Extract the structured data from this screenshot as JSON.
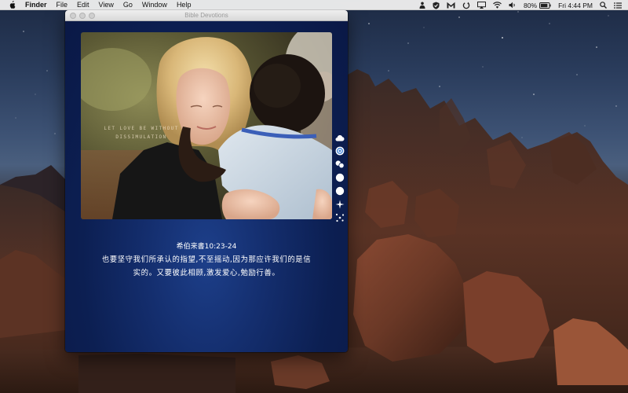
{
  "menubar": {
    "app_name": "Finder",
    "items": [
      "File",
      "Edit",
      "View",
      "Go",
      "Window",
      "Help"
    ],
    "battery_percent": "80%",
    "clock": "Fri 4:44 PM",
    "status_icons": [
      "user-icon",
      "shield-icon",
      "mail-icon",
      "sync-icon",
      "airplay-icon",
      "wifi-icon",
      "volume-icon",
      "battery-icon",
      "search-icon",
      "notification-center-icon"
    ]
  },
  "window": {
    "title": "Bible Devotions"
  },
  "photo": {
    "caption_line1": "LET LOVE BE WITHOUT",
    "caption_line2": "DISSIMULATION"
  },
  "toolbar": {
    "tools": [
      "cloud-icon",
      "refresh-icon",
      "share-icon",
      "circle-icon",
      "circle-icon",
      "sparkle-icon",
      "stars-icon"
    ]
  },
  "verse": {
    "reference": "希伯来書10:23-24",
    "line1": "也要坚守我们所承认的指望,不至摇动,因为那应许我们的是信",
    "line2": "实的。又要彼此相顾,激发爱心,勉励行善。"
  },
  "colors": {
    "window_background": "#0c1f52",
    "menubar_background": "#ececec",
    "verse_text": "#ffffff"
  }
}
